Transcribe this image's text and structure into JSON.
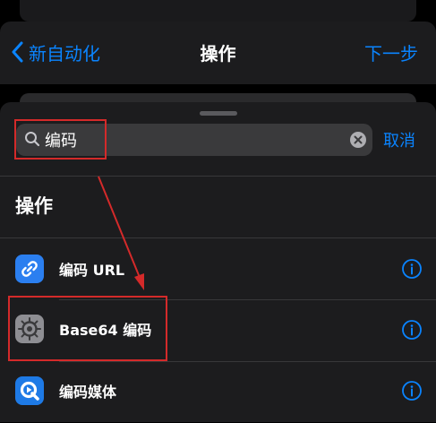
{
  "nav": {
    "back_label": "新自动化",
    "title": "操作",
    "next_label": "下一步"
  },
  "search": {
    "value": "编码",
    "cancel_label": "取消"
  },
  "section": {
    "title": "操作"
  },
  "actions": [
    {
      "label": "编码 URL",
      "icon": "link-icon"
    },
    {
      "label": "Base64 编码",
      "icon": "gear-icon"
    },
    {
      "label": "编码媒体",
      "icon": "quicktime-icon"
    }
  ],
  "colors": {
    "accent": "#0a84ff",
    "annotation": "#d42a2a",
    "background": "#1c1c1e"
  }
}
